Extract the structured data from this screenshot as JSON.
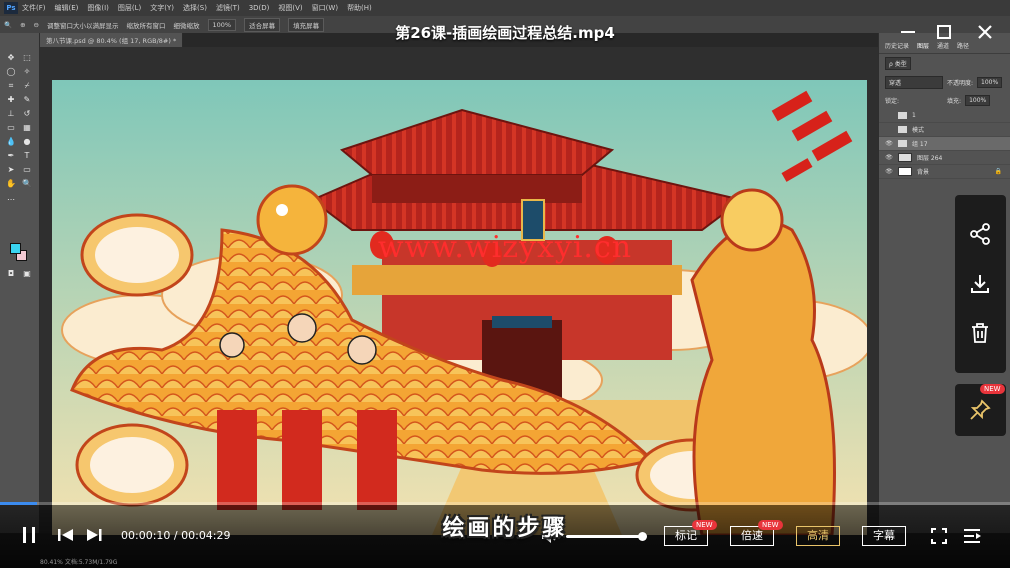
{
  "player": {
    "title": "第26课-插画绘画过程总结.mp4",
    "time_current": "00:00:10",
    "time_separator": " / ",
    "time_total": "00:04:29",
    "progress_fraction": 0.037,
    "volume_fraction": 1.0,
    "subtitle": "绘画的步骤",
    "watermark": "www.wizyxyi.cn",
    "buttons": {
      "mark": "标记",
      "speed": "倍速",
      "hd": "高清",
      "captions": "字幕"
    },
    "new_badge": "NEW",
    "accent_color": "#3c8cf0",
    "gold_color": "#e9c46a",
    "icons": [
      "pause-icon",
      "previous-icon",
      "next-icon",
      "volume-icon",
      "fullscreen-icon",
      "playlist-icon",
      "share-icon",
      "download-icon",
      "delete-icon",
      "pin-icon",
      "minimize-icon",
      "maximize-icon",
      "close-icon"
    ]
  },
  "photoshop": {
    "menu": [
      "文件(F)",
      "编辑(E)",
      "图像(I)",
      "图层(L)",
      "文字(Y)",
      "选择(S)",
      "滤镜(T)",
      "3D(D)",
      "视图(V)",
      "窗口(W)",
      "帮助(H)"
    ],
    "options": {
      "resize_windows": "调整窗口大小以满屏显示",
      "zoom_all": "缩放所有窗口",
      "scrubby_zoom": "细微缩放",
      "zoom_percent": "100%",
      "fit_screen": "适合屏幕",
      "fill_screen": "填充屏幕"
    },
    "doc_tab": "第八节课.psd @ 80.4% (组 17, RGB/8#) *",
    "panel_tabs": [
      "历史记录",
      "图层",
      "通道",
      "路径"
    ],
    "filter_kind": "ρ 类型",
    "blend_mode": "穿透",
    "opacity_label": "不透明度:",
    "opacity_value": "100%",
    "lock_label": "锁定:",
    "fill_label": "填充:",
    "fill_value": "100%",
    "layers": [
      {
        "name": "1",
        "type": "folder",
        "visible": false
      },
      {
        "name": "模式",
        "type": "folder",
        "visible": false
      },
      {
        "name": "组 17",
        "type": "folder",
        "visible": true,
        "selected": true
      },
      {
        "name": "图层 264",
        "type": "pixel",
        "visible": true
      },
      {
        "name": "背景",
        "type": "pixel",
        "visible": true,
        "locked": true
      }
    ],
    "status_zoom": "80.41%",
    "status_doc": "文档:5.73M/1.79G"
  }
}
